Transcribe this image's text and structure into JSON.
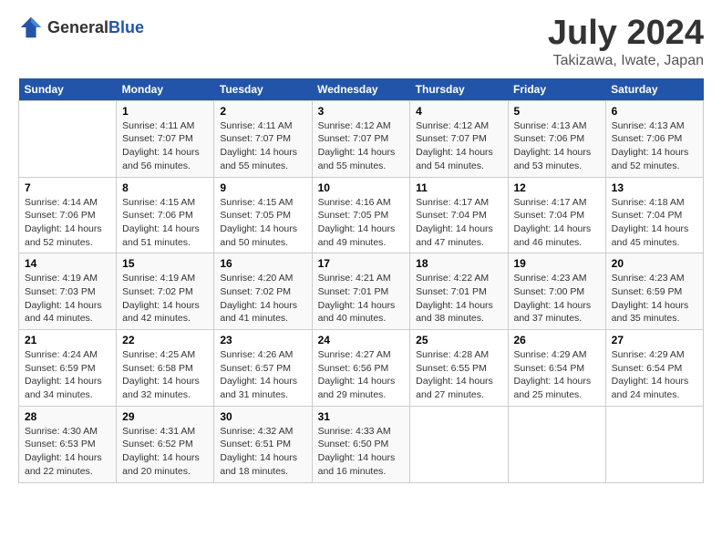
{
  "header": {
    "logo_general": "General",
    "logo_blue": "Blue",
    "title": "July 2024",
    "subtitle": "Takizawa, Iwate, Japan"
  },
  "days_of_week": [
    "Sunday",
    "Monday",
    "Tuesday",
    "Wednesday",
    "Thursday",
    "Friday",
    "Saturday"
  ],
  "weeks": [
    [
      {
        "day": "",
        "sunrise": "",
        "sunset": "",
        "daylight": ""
      },
      {
        "day": "1",
        "sunrise": "4:11 AM",
        "sunset": "7:07 PM",
        "daylight": "14 hours and 56 minutes."
      },
      {
        "day": "2",
        "sunrise": "4:11 AM",
        "sunset": "7:07 PM",
        "daylight": "14 hours and 55 minutes."
      },
      {
        "day": "3",
        "sunrise": "4:12 AM",
        "sunset": "7:07 PM",
        "daylight": "14 hours and 55 minutes."
      },
      {
        "day": "4",
        "sunrise": "4:12 AM",
        "sunset": "7:07 PM",
        "daylight": "14 hours and 54 minutes."
      },
      {
        "day": "5",
        "sunrise": "4:13 AM",
        "sunset": "7:06 PM",
        "daylight": "14 hours and 53 minutes."
      },
      {
        "day": "6",
        "sunrise": "4:13 AM",
        "sunset": "7:06 PM",
        "daylight": "14 hours and 52 minutes."
      }
    ],
    [
      {
        "day": "7",
        "sunrise": "4:14 AM",
        "sunset": "7:06 PM",
        "daylight": "14 hours and 52 minutes."
      },
      {
        "day": "8",
        "sunrise": "4:15 AM",
        "sunset": "7:06 PM",
        "daylight": "14 hours and 51 minutes."
      },
      {
        "day": "9",
        "sunrise": "4:15 AM",
        "sunset": "7:05 PM",
        "daylight": "14 hours and 50 minutes."
      },
      {
        "day": "10",
        "sunrise": "4:16 AM",
        "sunset": "7:05 PM",
        "daylight": "14 hours and 49 minutes."
      },
      {
        "day": "11",
        "sunrise": "4:17 AM",
        "sunset": "7:04 PM",
        "daylight": "14 hours and 47 minutes."
      },
      {
        "day": "12",
        "sunrise": "4:17 AM",
        "sunset": "7:04 PM",
        "daylight": "14 hours and 46 minutes."
      },
      {
        "day": "13",
        "sunrise": "4:18 AM",
        "sunset": "7:04 PM",
        "daylight": "14 hours and 45 minutes."
      }
    ],
    [
      {
        "day": "14",
        "sunrise": "4:19 AM",
        "sunset": "7:03 PM",
        "daylight": "14 hours and 44 minutes."
      },
      {
        "day": "15",
        "sunrise": "4:19 AM",
        "sunset": "7:02 PM",
        "daylight": "14 hours and 42 minutes."
      },
      {
        "day": "16",
        "sunrise": "4:20 AM",
        "sunset": "7:02 PM",
        "daylight": "14 hours and 41 minutes."
      },
      {
        "day": "17",
        "sunrise": "4:21 AM",
        "sunset": "7:01 PM",
        "daylight": "14 hours and 40 minutes."
      },
      {
        "day": "18",
        "sunrise": "4:22 AM",
        "sunset": "7:01 PM",
        "daylight": "14 hours and 38 minutes."
      },
      {
        "day": "19",
        "sunrise": "4:23 AM",
        "sunset": "7:00 PM",
        "daylight": "14 hours and 37 minutes."
      },
      {
        "day": "20",
        "sunrise": "4:23 AM",
        "sunset": "6:59 PM",
        "daylight": "14 hours and 35 minutes."
      }
    ],
    [
      {
        "day": "21",
        "sunrise": "4:24 AM",
        "sunset": "6:59 PM",
        "daylight": "14 hours and 34 minutes."
      },
      {
        "day": "22",
        "sunrise": "4:25 AM",
        "sunset": "6:58 PM",
        "daylight": "14 hours and 32 minutes."
      },
      {
        "day": "23",
        "sunrise": "4:26 AM",
        "sunset": "6:57 PM",
        "daylight": "14 hours and 31 minutes."
      },
      {
        "day": "24",
        "sunrise": "4:27 AM",
        "sunset": "6:56 PM",
        "daylight": "14 hours and 29 minutes."
      },
      {
        "day": "25",
        "sunrise": "4:28 AM",
        "sunset": "6:55 PM",
        "daylight": "14 hours and 27 minutes."
      },
      {
        "day": "26",
        "sunrise": "4:29 AM",
        "sunset": "6:54 PM",
        "daylight": "14 hours and 25 minutes."
      },
      {
        "day": "27",
        "sunrise": "4:29 AM",
        "sunset": "6:54 PM",
        "daylight": "14 hours and 24 minutes."
      }
    ],
    [
      {
        "day": "28",
        "sunrise": "4:30 AM",
        "sunset": "6:53 PM",
        "daylight": "14 hours and 22 minutes."
      },
      {
        "day": "29",
        "sunrise": "4:31 AM",
        "sunset": "6:52 PM",
        "daylight": "14 hours and 20 minutes."
      },
      {
        "day": "30",
        "sunrise": "4:32 AM",
        "sunset": "6:51 PM",
        "daylight": "14 hours and 18 minutes."
      },
      {
        "day": "31",
        "sunrise": "4:33 AM",
        "sunset": "6:50 PM",
        "daylight": "14 hours and 16 minutes."
      },
      {
        "day": "",
        "sunrise": "",
        "sunset": "",
        "daylight": ""
      },
      {
        "day": "",
        "sunrise": "",
        "sunset": "",
        "daylight": ""
      },
      {
        "day": "",
        "sunrise": "",
        "sunset": "",
        "daylight": ""
      }
    ]
  ],
  "labels": {
    "sunrise_prefix": "Sunrise: ",
    "sunset_prefix": "Sunset: ",
    "daylight_prefix": "Daylight: "
  }
}
